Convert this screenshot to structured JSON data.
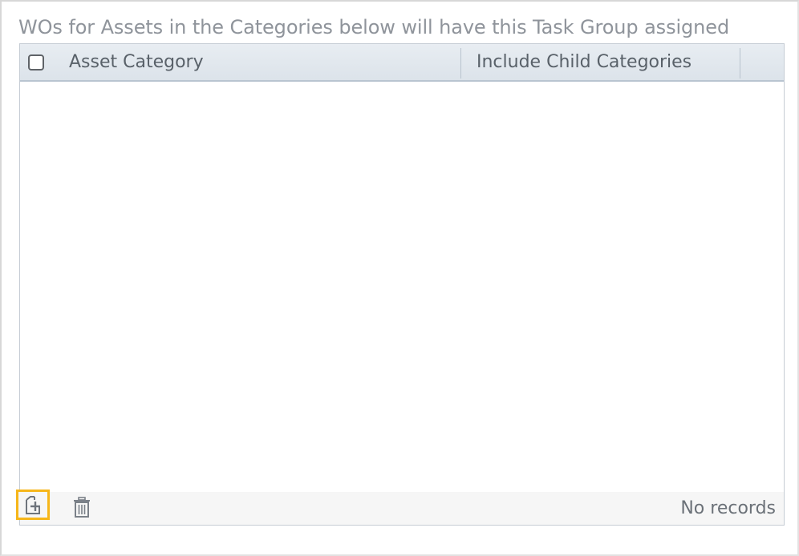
{
  "caption": "WOs for Assets in the Categories below will have this Task Group assigned",
  "grid": {
    "columns": [
      {
        "label": "Asset Category"
      },
      {
        "label": "Include Child Categories"
      }
    ],
    "rows": [],
    "select_all_checked": false
  },
  "footer": {
    "add_icon": "add-record-icon",
    "delete_icon": "trash-icon",
    "status_text": "No records"
  },
  "colors": {
    "highlight": "#f6b61a",
    "header_bg": "#e2e8ee",
    "caption_text": "#8f949b"
  }
}
